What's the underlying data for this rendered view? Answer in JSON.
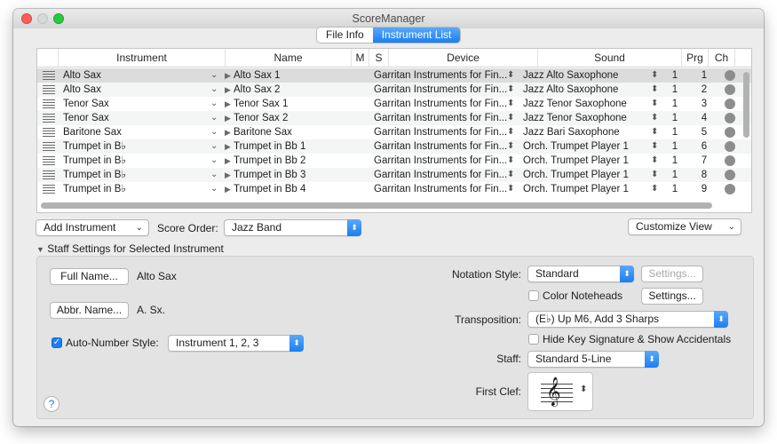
{
  "window": {
    "title": "ScoreManager"
  },
  "tabs": [
    {
      "label": "File Info",
      "active": false
    },
    {
      "label": "Instrument List",
      "active": true
    }
  ],
  "table": {
    "columns": [
      "Instrument",
      "Name",
      "M",
      "S",
      "Device",
      "Sound",
      "Prg",
      "Ch"
    ],
    "rows": [
      {
        "instrument": "Alto Sax",
        "name": "Alto Sax 1",
        "device": "Garritan Instruments for Fin...",
        "sound": "Jazz Alto Saxophone",
        "prg": "1",
        "ch": "1"
      },
      {
        "instrument": "Alto Sax",
        "name": "Alto Sax 2",
        "device": "Garritan Instruments for Fin...",
        "sound": "Jazz Alto Saxophone",
        "prg": "1",
        "ch": "2"
      },
      {
        "instrument": "Tenor Sax",
        "name": "Tenor Sax 1",
        "device": "Garritan Instruments for Fin...",
        "sound": "Jazz Tenor Saxophone",
        "prg": "1",
        "ch": "3"
      },
      {
        "instrument": "Tenor Sax",
        "name": "Tenor Sax 2",
        "device": "Garritan Instruments for Fin...",
        "sound": "Jazz Tenor Saxophone",
        "prg": "1",
        "ch": "4"
      },
      {
        "instrument": "Baritone Sax",
        "name": "Baritone Sax",
        "device": "Garritan Instruments for Fin...",
        "sound": "Jazz Bari Saxophone",
        "prg": "1",
        "ch": "5"
      },
      {
        "instrument": "Trumpet in B♭",
        "name": "Trumpet in Bb 1",
        "device": "Garritan Instruments for Fin...",
        "sound": "Orch. Trumpet Player 1",
        "prg": "1",
        "ch": "6"
      },
      {
        "instrument": "Trumpet in B♭",
        "name": "Trumpet in Bb 2",
        "device": "Garritan Instruments for Fin...",
        "sound": "Orch. Trumpet Player 1",
        "prg": "1",
        "ch": "7"
      },
      {
        "instrument": "Trumpet in B♭",
        "name": "Trumpet in Bb 3",
        "device": "Garritan Instruments for Fin...",
        "sound": "Orch. Trumpet Player 1",
        "prg": "1",
        "ch": "8"
      },
      {
        "instrument": "Trumpet in B♭",
        "name": "Trumpet in Bb 4",
        "device": "Garritan Instruments for Fin...",
        "sound": "Orch. Trumpet Player 1",
        "prg": "1",
        "ch": "9"
      }
    ]
  },
  "toolbar": {
    "add_instrument": "Add Instrument",
    "score_order_label": "Score Order:",
    "score_order_value": "Jazz Band",
    "customize_view": "Customize View"
  },
  "staff_settings": {
    "disclosure_label": "Staff Settings for Selected Instrument",
    "full_name_button": "Full Name...",
    "full_name_value": "Alto Sax",
    "abbr_name_button": "Abbr. Name...",
    "abbr_name_value": "A. Sx.",
    "auto_number_label": "Auto-Number Style:",
    "auto_number_value": "Instrument 1, 2, 3",
    "notation_style_label": "Notation Style:",
    "notation_style_value": "Standard",
    "notation_settings_button": "Settings...",
    "color_noteheads_label": "Color Noteheads",
    "color_settings_button": "Settings...",
    "transposition_label": "Transposition:",
    "transposition_value": "(E♭) Up M6, Add 3 Sharps",
    "hide_key_label": "Hide Key Signature & Show Accidentals",
    "staff_label": "Staff:",
    "staff_value": "Standard 5-Line",
    "first_clef_label": "First Clef:",
    "help_glyph": "?"
  },
  "icons": {
    "clef": "𝄞",
    "row_caret": "▶",
    "updown": "⬍",
    "chevron": "⌄",
    "checkmark": "✓",
    "disclosure": "▼"
  },
  "colors": {
    "accent": "#1a7ff1",
    "selected_row": "#dcdcdc"
  }
}
